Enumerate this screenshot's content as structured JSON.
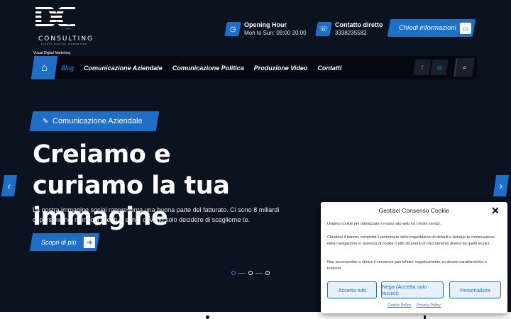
{
  "brand": {
    "logo_letters": "DC",
    "logo_word": "CONSULTING",
    "logo_tag": "VISUAL DIGITAL MARKETING",
    "subtitle": "Visual Digital Marketing"
  },
  "header": {
    "hours_title": "Opening Hour",
    "hours_value": "Mon to Sun: 09:00 20:00",
    "contact_title": "Contatto diretto",
    "contact_value": "3338235582",
    "cta_label": "Chiedi informazioni"
  },
  "nav": {
    "items": [
      {
        "label": "Blog",
        "active": true
      },
      {
        "label": "Comunicazione Aziendale"
      },
      {
        "label": "Comunicazione Politica"
      },
      {
        "label": "Produzione Video"
      },
      {
        "label": "Contatti"
      }
    ],
    "social": [
      "facebook-icon",
      "instagram-icon"
    ]
  },
  "hero": {
    "badge": "Comunicazione Aziendale",
    "title": "Creiamo e curiamo la tua immagine",
    "text": "La nostra immagine social rappresenta una buona parte del fatturato. Ci sono 8 miliardi di persone nel mondo: i clienti ci sono, devono solo decidere di sceglierne te.",
    "button": "Scopri di più"
  },
  "cookie": {
    "title": "Gestisci Consenso Cookie",
    "p1": "Usiamo cookie per ottimizzare il nostro sito web ed i nostri servizi.",
    "p2": "Chiudere il banner comporta il permanere delle impostazioni di default e dunque la continuazione della navigazione in assenza di cookie o altri strumenti di tracciamento diversi da quelli tecnici.",
    "p3": "Non acconsentire o ritirare il consenso può influire negativamente su alcune caratteristiche e funzioni.",
    "accept": "Accetta tutti",
    "deny": "Nega (Accetta solo tecnici)",
    "customize": "Personalizza",
    "link_cookie": "Cookie Policy",
    "link_privacy": "Privacy Policy"
  },
  "colors": {
    "accent": "#1f6fc9",
    "background": "#0b1220"
  }
}
